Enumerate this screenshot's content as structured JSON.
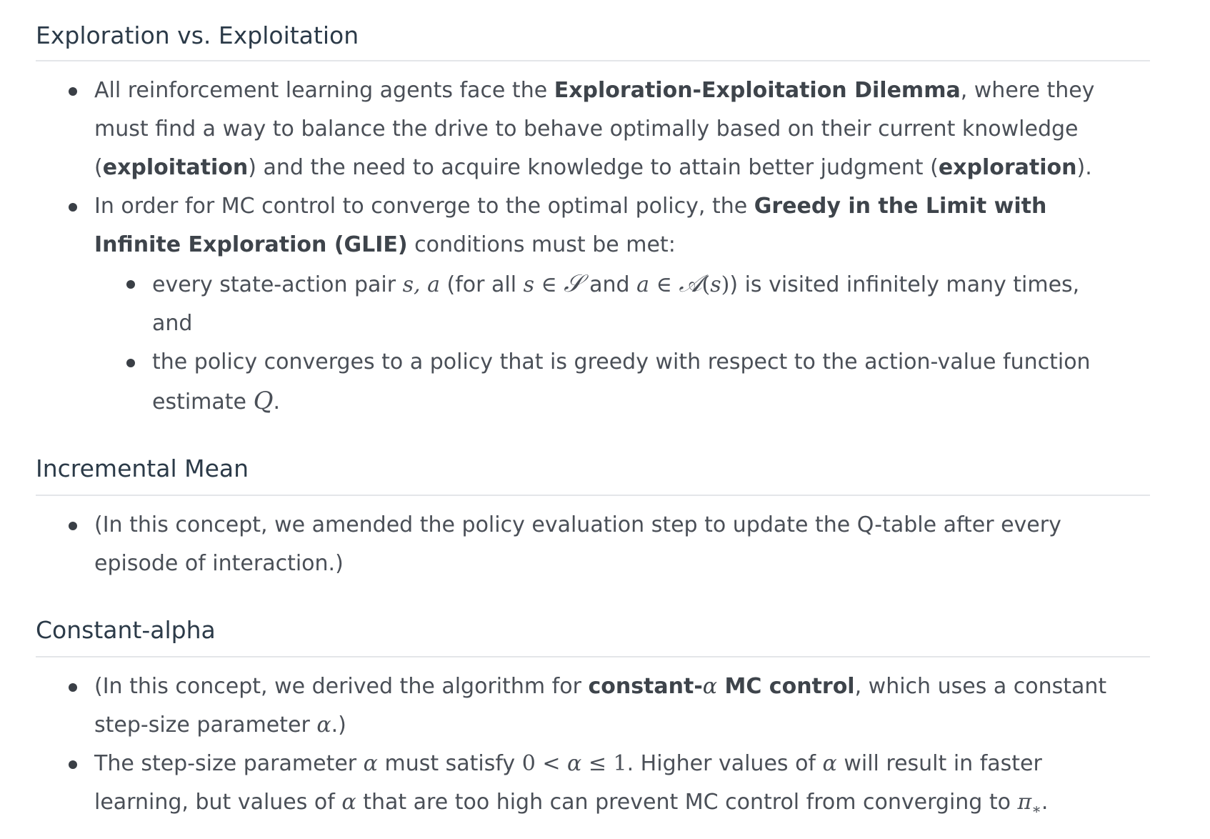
{
  "sections": [
    {
      "heading": "Exploration vs. Exploitation",
      "items": [
        {
          "t1": "All reinforcement learning agents face the ",
          "b1": "Exploration-Exploitation Dilemma",
          "t2": ", where they must find a way to balance the drive to behave optimally based on their current knowledge (",
          "b2": "exploitation",
          "t3": ") and the need to acquire knowledge to attain better judgment (",
          "b3": "exploration",
          "t4": ")."
        },
        {
          "t1": "In order for MC control to converge to the optimal policy, the ",
          "b1": "Greedy in the Limit with Infinite Exploration (GLIE)",
          "t2": " conditions must be met:",
          "sub": [
            {
              "t1": "every state-action pair ",
              "m1": "s, a",
              "t2": " (for all ",
              "m2a": "s",
              "m2b": " ∈ ",
              "m2c": "𝒮",
              "t3": " and ",
              "m3a": "a",
              "m3b": " ∈ ",
              "m3c": "𝒜",
              "m3d": "(",
              "m3e": "s",
              "m3f": ")",
              "t4": ") is visited infinitely many times, and"
            },
            {
              "t1": "the policy converges to a policy that is greedy with respect to the action-value function estimate ",
              "m1": "Q",
              "t2": "."
            }
          ]
        }
      ]
    },
    {
      "heading": "Incremental Mean",
      "items": [
        {
          "t1": "(In this concept, we amended the policy evaluation step to update the Q-table after every episode of interaction.)"
        }
      ]
    },
    {
      "heading": "Constant-alpha",
      "items": [
        {
          "t1": "(In this concept, we derived the algorithm for ",
          "b1a": "constant-",
          "b1m": "α",
          "b1b": " MC control",
          "t2": ", which uses a constant step-size parameter ",
          "m1": "α",
          "t3": ".)"
        },
        {
          "t1": "The step-size parameter ",
          "m1": "α",
          "t2": " must satisfy ",
          "m2a": "0",
          "m2b": " < ",
          "m2c": "α",
          "m2d": " ≤ ",
          "m2e": "1",
          "t3": ". Higher values of ",
          "m3": "α",
          "t4": " will result in faster learning, but values of ",
          "m4": "α",
          "t5": " that are too high can prevent MC control from converging to ",
          "m5": "π",
          "m5sub": "∗",
          "t6": "."
        }
      ]
    }
  ],
  "colors": {
    "heading": "#2b3a48",
    "body_text": "#4a4f57",
    "rule": "#e4e6e9",
    "bullet": "#3a3f46"
  }
}
